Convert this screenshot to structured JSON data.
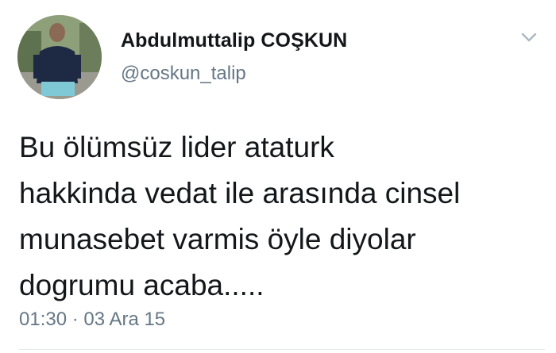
{
  "author": {
    "display_name": "Abdulmuttalip COŞKUN",
    "handle": "@coskun_talip",
    "avatar_icon": "profile-photo"
  },
  "tweet": {
    "text": "Bu ölümsüz lider ataturk\nhakkinda vedat ile arasında cinsel\nmunasebet varmis öyle diyolar\ndogrumu  acaba.....",
    "time": "01:30",
    "separator": "·",
    "date": "03 Ara 15"
  },
  "menu": {
    "icon": "chevron-down-icon"
  },
  "colors": {
    "text_primary": "#14171a",
    "text_secondary": "#657786",
    "chevron": "#aab8c2"
  }
}
